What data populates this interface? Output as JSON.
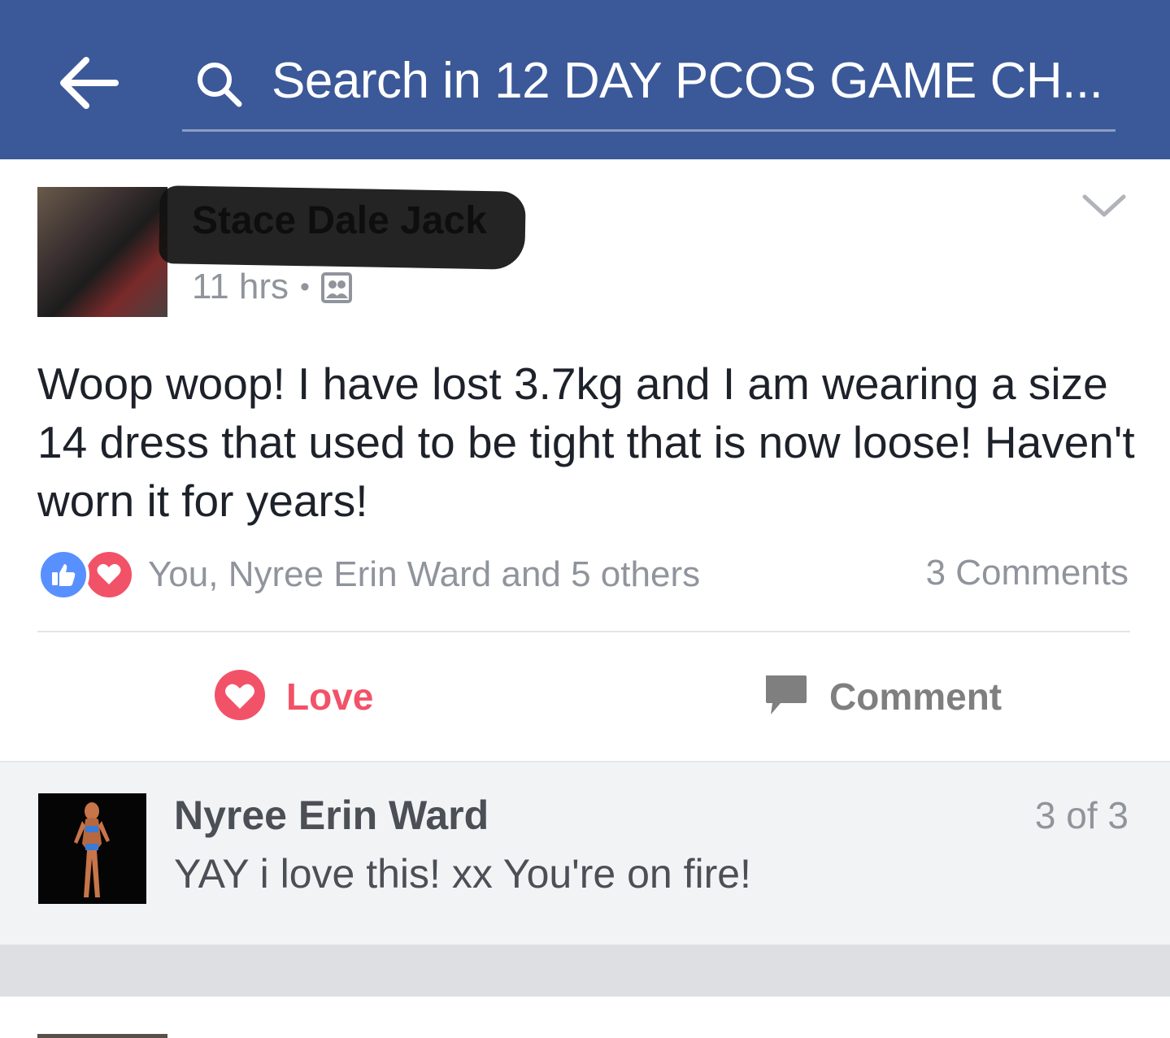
{
  "header": {
    "search_placeholder": "Search in 12 DAY PCOS GAME CH..."
  },
  "post": {
    "author": "Stace Dale Jack",
    "time": "11 hrs",
    "meta_separator": "•",
    "privacy_icon": "group-icon",
    "body": "Woop woop! I have lost 3.7kg and I am wearing a size 14 dress that used to be tight that is now loose! Haven't worn it for years!",
    "reactions": {
      "icons": [
        "like-icon",
        "love-icon"
      ],
      "summary": "You, Nyree Erin Ward and 5 others"
    },
    "comments_count": "3 Comments",
    "actions": {
      "love_label": "Love",
      "comment_label": "Comment"
    }
  },
  "comment_preview": {
    "author": "Nyree Erin Ward",
    "text": "YAY i love this! xx You're on fire!",
    "pager": "3 of 3"
  },
  "colors": {
    "header_bg": "#3b5998",
    "love": "#f25268",
    "like": "#5890ff",
    "muted_text": "#90949c"
  }
}
